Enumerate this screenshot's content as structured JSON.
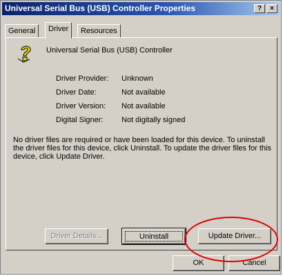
{
  "window": {
    "title": "Universal Serial Bus (USB) Controller Properties",
    "help_button": "?",
    "close_button": "×"
  },
  "tabs": [
    {
      "label": "General"
    },
    {
      "label": "Driver"
    },
    {
      "label": "Resources"
    }
  ],
  "device": {
    "name": "Universal Serial Bus (USB) Controller",
    "icon": "question-mark-device-icon"
  },
  "driver_info": {
    "provider_label": "Driver Provider:",
    "provider_value": "Unknown",
    "date_label": "Driver Date:",
    "date_value": "Not available",
    "version_label": "Driver Version:",
    "version_value": "Not available",
    "signer_label": "Digital Signer:",
    "signer_value": "Not digitally signed"
  },
  "description": "No driver files are required or have been loaded for this device. To uninstall the driver files for this device, click Uninstall. To update the driver files for this device, click Update Driver.",
  "buttons": {
    "driver_details": "Driver Details...",
    "uninstall": "Uninstall",
    "update_driver": "Update Driver...",
    "ok": "OK",
    "cancel": "Cancel"
  },
  "colors": {
    "titlebar": "#0a246a",
    "dialog_face": "#d4d0c8",
    "highlight_circle": "#e00000"
  }
}
